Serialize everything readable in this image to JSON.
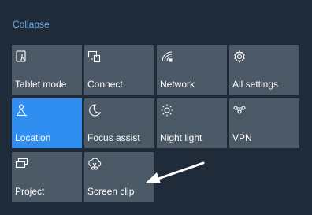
{
  "header": {
    "collapse_label": "Collapse"
  },
  "tiles": [
    {
      "label": "Tablet mode",
      "icon": "tablet-mode-icon",
      "active": false
    },
    {
      "label": "Connect",
      "icon": "connect-icon",
      "active": false
    },
    {
      "label": "Network",
      "icon": "network-icon",
      "active": false
    },
    {
      "label": "All settings",
      "icon": "settings-gear-icon",
      "active": false
    },
    {
      "label": "Location",
      "icon": "location-icon",
      "active": true
    },
    {
      "label": "Focus assist",
      "icon": "focus-assist-moon-icon",
      "active": false
    },
    {
      "label": "Night light",
      "icon": "night-light-icon",
      "active": false
    },
    {
      "label": "VPN",
      "icon": "vpn-icon",
      "active": false
    },
    {
      "label": "Project",
      "icon": "project-icon",
      "active": false
    },
    {
      "label": "Screen clip",
      "icon": "screen-clip-icon",
      "active": false
    }
  ],
  "colors": {
    "background": "#1f2b38",
    "tile": "#4b5866",
    "tile_active": "#2f8ef0",
    "link": "#6ea9e6"
  }
}
